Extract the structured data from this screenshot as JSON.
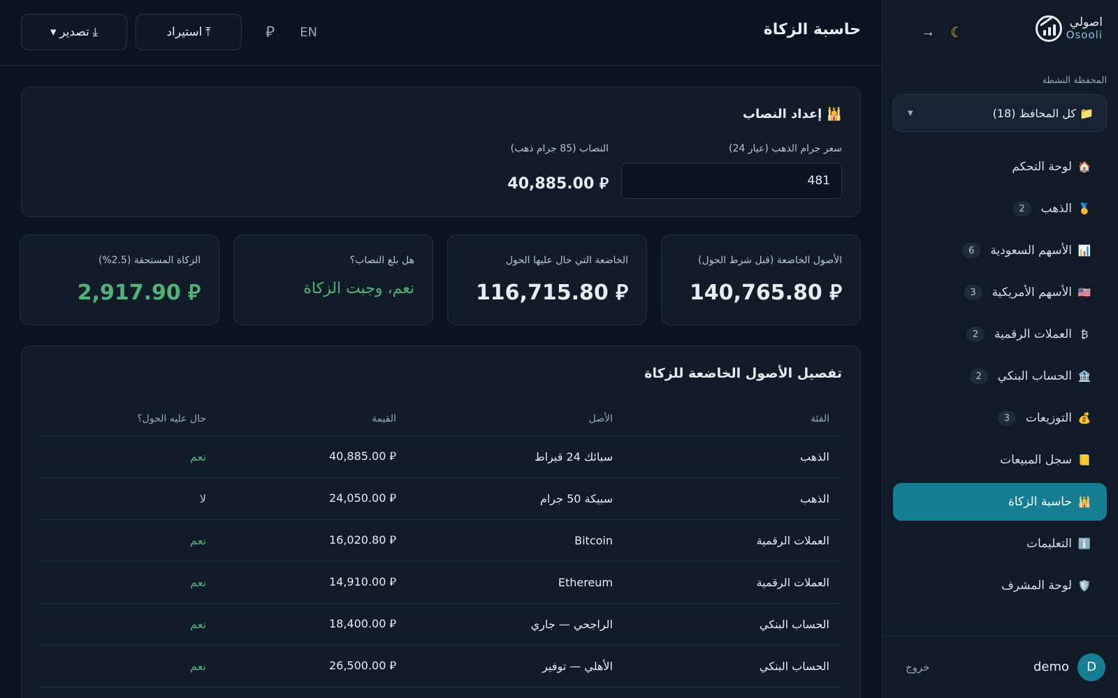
{
  "brand": {
    "name_ar": "اصولي",
    "name_en": "Osooli"
  },
  "sidebar": {
    "portfolio_label": "المحفظة النشطة",
    "portfolio_value": "📁 كل المحافظ (18)",
    "items": [
      {
        "icon": "🏠",
        "label": "لوحة التحكم",
        "count": ""
      },
      {
        "icon": "🥇",
        "label": "الذهب",
        "count": "2"
      },
      {
        "icon": "📊",
        "label": "الأسهم السعودية",
        "count": "6"
      },
      {
        "icon": "🇺🇸",
        "label": "الأسهم الأمريكية",
        "count": "3"
      },
      {
        "icon": "₿",
        "label": "العملات الرقمية",
        "count": "2"
      },
      {
        "icon": "🏦",
        "label": "الحساب البنكي",
        "count": "2"
      },
      {
        "icon": "💰",
        "label": "التوزيعات",
        "count": "3"
      },
      {
        "icon": "📒",
        "label": "سجل المبيعات",
        "count": ""
      },
      {
        "icon": "🕌",
        "label": "حاسبة الزكاة",
        "count": ""
      },
      {
        "icon": "ℹ️",
        "label": "التعليمات",
        "count": ""
      },
      {
        "icon": "🛡️",
        "label": "لوحة المشرف",
        "count": ""
      }
    ],
    "user": {
      "initial": "D",
      "name": "demo",
      "logout": "خروج"
    }
  },
  "header": {
    "title": "حاسبة الزكاة",
    "export_label": "⤓ تصدير ▾",
    "import_label": "⤒ استيراد",
    "currency_symbol": "⃁",
    "lang": "EN"
  },
  "nisab": {
    "title": "🕌 إعداد النصاب",
    "gold_price_label": "سعر جرام الذهب (عيار 24)",
    "gold_price_value": "481",
    "nisab_label": "النصاب (85 جرام ذهب)",
    "nisab_value": "40,885.00 ⃁"
  },
  "stats": [
    {
      "label": "الأصول الخاضعة (قبل شرط الحول)",
      "value": "140,765.80 ⃁"
    },
    {
      "label": "الخاضعة التي حال عليها الحول",
      "value": "116,715.80 ⃁"
    },
    {
      "label": "هل بلغ النصاب؟",
      "value": "نعم، وجبت الزكاة"
    },
    {
      "label": "الزكاة المستحقة (2.5%)",
      "value": "2,917.90 ⃁"
    }
  ],
  "table": {
    "title": "تفصيل الأصول الخاضعة للزكاة",
    "headers": {
      "category": "الفئة",
      "asset": "الأصل",
      "value": "القيمة",
      "hawl": "حال عليه الحول؟"
    },
    "rows": [
      {
        "category": "الذهب",
        "asset": "سبائك 24 قيراط",
        "value": "40,885.00 ⃁",
        "hawl": "نعم"
      },
      {
        "category": "الذهب",
        "asset": "سبيكة 50 جرام",
        "value": "24,050.00 ⃁",
        "hawl": "لا"
      },
      {
        "category": "العملات الرقمية",
        "asset": "Bitcoin",
        "value": "16,020.80 ⃁",
        "hawl": "نعم"
      },
      {
        "category": "العملات الرقمية",
        "asset": "Ethereum",
        "value": "14,910.00 ⃁",
        "hawl": "نعم"
      },
      {
        "category": "الحساب البنكي",
        "asset": "الراجحي — جاري",
        "value": "18,400.00 ⃁",
        "hawl": "نعم"
      },
      {
        "category": "الحساب البنكي",
        "asset": "الأهلي — توفير",
        "value": "26,500.00 ⃁",
        "hawl": "نعم"
      }
    ]
  },
  "colors": {
    "accent": "#167e92",
    "positive": "#4fb37a",
    "bg": "#0b1220",
    "card": "#121b28"
  }
}
